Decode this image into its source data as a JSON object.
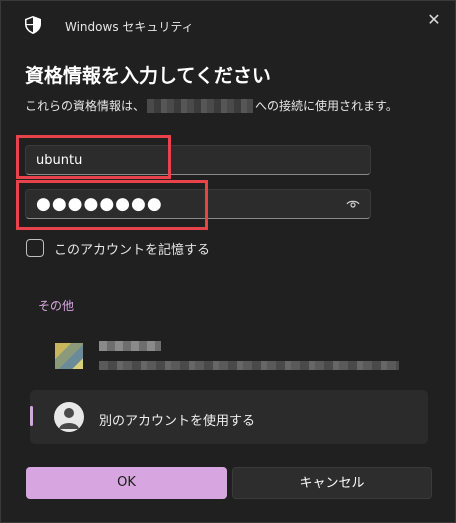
{
  "window": {
    "app_title": "Windows セキュリティ",
    "close_glyph": "✕",
    "icon": "shield-icon"
  },
  "dialog": {
    "heading": "資格情報を入力してください",
    "subtext_before": "これらの資格情報は、",
    "subtext_after": "への接続に使用されます。"
  },
  "fields": {
    "username_value": "ubuntu",
    "password_mask": "●●●●●●●●"
  },
  "remember": {
    "label": "このアカウントを記憶する",
    "checked": false
  },
  "other_section": {
    "heading": "その他",
    "use_other_label": "別のアカウントを使用する"
  },
  "buttons": {
    "ok": "OK",
    "cancel": "キャンセル"
  },
  "colors": {
    "accent": "#d7a6e0",
    "highlight": "#e8434a",
    "background": "#202020"
  }
}
